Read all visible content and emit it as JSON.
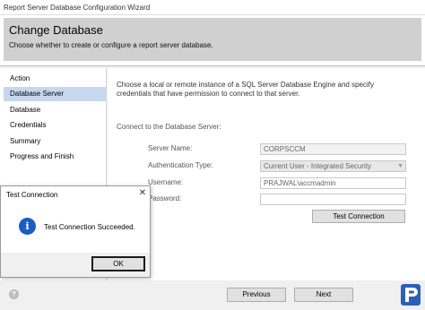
{
  "window": {
    "title": "Report Server Database Configuration Wizard"
  },
  "header": {
    "title": "Change Database",
    "subtitle": "Choose whether to create or configure a report server database."
  },
  "sidebar": {
    "items": [
      {
        "label": "Action"
      },
      {
        "label": "Database Server"
      },
      {
        "label": "Database"
      },
      {
        "label": "Credentials"
      },
      {
        "label": "Summary"
      },
      {
        "label": "Progress and Finish"
      }
    ],
    "selected": "Database Server"
  },
  "main": {
    "description": "Choose a local or remote instance of a SQL Server Database Engine and specify credentials that have permission to connect to that server.",
    "connect_label": "Connect to the Database Server:",
    "server_name": {
      "label": "Server Name:",
      "value": "CORPSCCM"
    },
    "auth_type": {
      "label": "Authentication Type:",
      "value": "Current User - Integrated Security"
    },
    "username": {
      "label": "Username:",
      "value": "PRAJWAL\\accmadmin"
    },
    "password": {
      "label": "Password:",
      "value": ""
    },
    "test_button": "Test Connection"
  },
  "footer": {
    "previous": "Previous",
    "next": "Next",
    "help": "?"
  },
  "dialog": {
    "title": "Test Connection",
    "close": "✕",
    "icon_glyph": "i",
    "message": "Test Connection Succeeded.",
    "ok": "OK"
  },
  "colors": {
    "selection": "#c7d8ee",
    "info_icon": "#1b5cc7",
    "logo": "#2d5fb8"
  }
}
